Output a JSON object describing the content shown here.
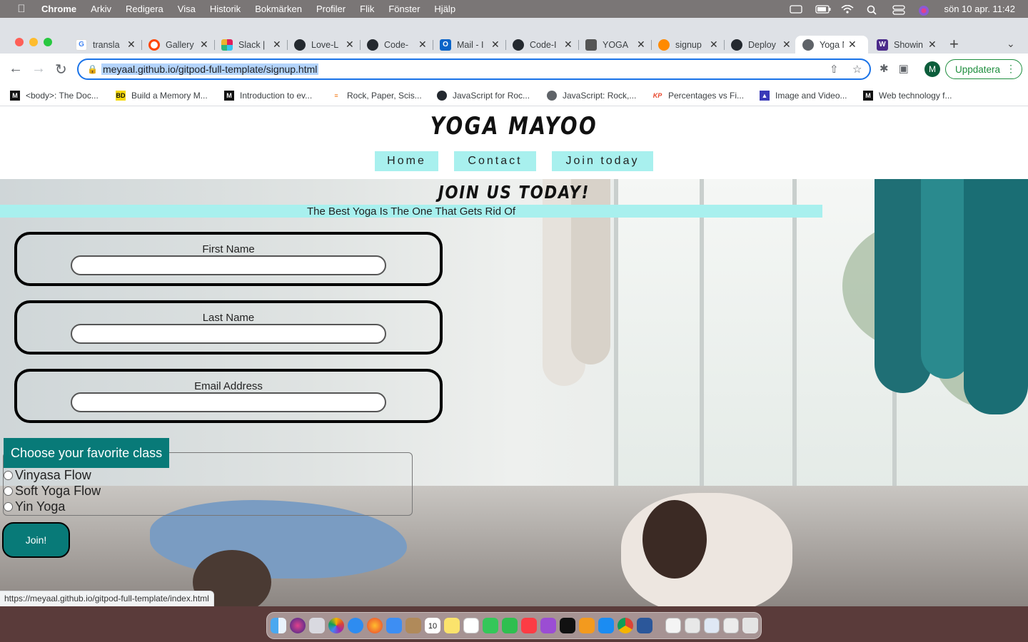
{
  "menubar": {
    "app_name": "Chrome",
    "menus": [
      "Arkiv",
      "Redigera",
      "Visa",
      "Historik",
      "Bokmärken",
      "Profiler",
      "Flik",
      "Fönster",
      "Hjälp"
    ],
    "datetime": "sön 10 apr.  11:42"
  },
  "tabs": [
    {
      "label": "transla",
      "icon": "google-icon",
      "color": "#ffffff"
    },
    {
      "label": "Gallery",
      "icon": "circle-icon",
      "color": "#ff4500"
    },
    {
      "label": "Slack |",
      "icon": "slack-icon",
      "color": "#4a154b"
    },
    {
      "label": "Love-L",
      "icon": "github-icon",
      "color": "#24292f"
    },
    {
      "label": "Code-",
      "icon": "github-icon",
      "color": "#24292f"
    },
    {
      "label": "Mail - I",
      "icon": "outlook-icon",
      "color": "#0a64c8"
    },
    {
      "label": "Code-I",
      "icon": "github-icon",
      "color": "#24292f"
    },
    {
      "label": "YOGA",
      "icon": "cube-icon",
      "color": "#555555"
    },
    {
      "label": "signup",
      "icon": "gitpod-icon",
      "color": "#ff8a00"
    },
    {
      "label": "Deploy",
      "icon": "github-icon",
      "color": "#24292f"
    },
    {
      "label": "Yoga M",
      "icon": "globe-icon",
      "color": "#5f6368",
      "active": true
    },
    {
      "label": "Showin",
      "icon": "w3-icon",
      "color": "#4b2a8a"
    }
  ],
  "toolbar": {
    "url": "meyaal.github.io/gitpod-full-template/signup.html",
    "profile_initial": "M",
    "update_label": "Uppdatera"
  },
  "bookmarks": [
    {
      "label": "<body>: The Doc...",
      "icon": "mdn-icon"
    },
    {
      "label": "Build a Memory M...",
      "icon": "bd-icon"
    },
    {
      "label": "Introduction to ev...",
      "icon": "mdn-icon"
    },
    {
      "label": "Rock, Paper, Scis...",
      "icon": "stackoverflow-icon"
    },
    {
      "label": "JavaScript for Roc...",
      "icon": "github-icon"
    },
    {
      "label": "JavaScript: Rock,...",
      "icon": "globe-icon"
    },
    {
      "label": "Percentages vs Fi...",
      "icon": "kp-icon"
    },
    {
      "label": "Image and Video...",
      "icon": "image-icon"
    },
    {
      "label": "Web technology f...",
      "icon": "mdn-icon"
    }
  ],
  "site": {
    "title": "YOGA MAYOO",
    "nav": [
      "Home",
      "Contact",
      "Join today"
    ],
    "join_title": "JOIN US TODAY!",
    "tagline": "The Best Yoga Is The One That Gets Rid Of",
    "fields": [
      {
        "label": "First Name",
        "value": ""
      },
      {
        "label": "Last Name",
        "value": ""
      },
      {
        "label": "Email Address",
        "value": ""
      }
    ],
    "class_legend": "Choose your favorite class",
    "classes": [
      "Vinyasa Flow",
      "Soft Yoga Flow",
      "Yin Yoga"
    ],
    "submit_label": "Join!"
  },
  "status_url": "https://meyaal.github.io/gitpod-full-template/index.html",
  "colors": {
    "accent_teal": "#087a78",
    "nav_cyan": "#a8f0ee",
    "chrome_blue": "#1a73e8",
    "update_green": "#1e8e3e"
  },
  "dock": {
    "calendar_day": "10",
    "apps": [
      "finder-icon",
      "siri-icon",
      "launchpad-icon",
      "photos-icon",
      "safari-icon",
      "firefox-icon",
      "mail-icon",
      "contacts-icon",
      "calendar-icon",
      "notes-icon",
      "reminders-icon",
      "messages-icon",
      "facetime-icon",
      "music-icon",
      "podcasts-icon",
      "tv-icon",
      "books-icon",
      "appstore-icon",
      "chrome-icon",
      "word-icon",
      "preview-icon",
      "screenshot-icon",
      "window-icon",
      "finder-window-icon",
      "trash-icon"
    ]
  }
}
